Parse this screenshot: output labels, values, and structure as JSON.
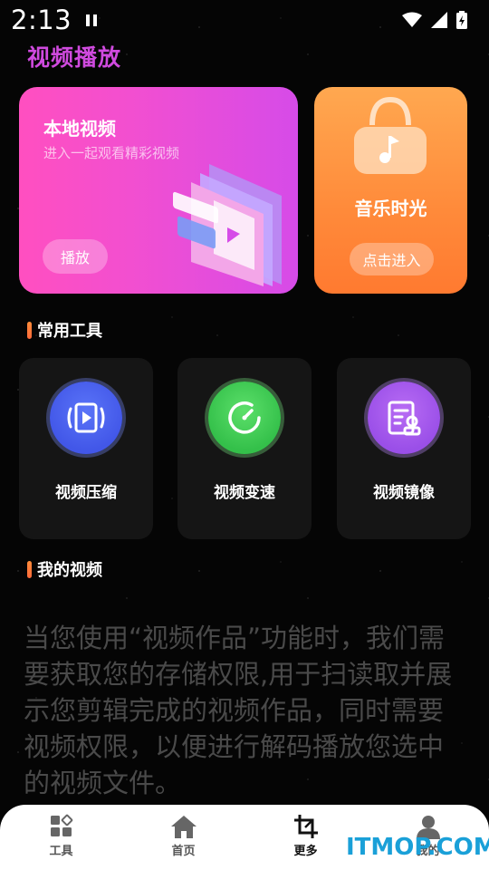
{
  "status_bar": {
    "time": "2:13"
  },
  "page_title": "视频播放",
  "local_video": {
    "title": "本地视频",
    "subtitle": "进入一起观看精彩视频",
    "button": "播放"
  },
  "music": {
    "title": "音乐时光",
    "button": "点击进入"
  },
  "tools_section": {
    "title": "常用工具",
    "items": [
      {
        "label": "视频压缩",
        "icon": "video-compress-icon",
        "color": "#4a5ef0"
      },
      {
        "label": "视频变速",
        "icon": "speedometer-icon",
        "color": "#3ccc50"
      },
      {
        "label": "视频镜像",
        "icon": "mirror-document-icon",
        "color": "#a45af0"
      }
    ]
  },
  "my_video_section": {
    "title": "我的视频"
  },
  "permission_text": "当您使用“视频作品”功能时，我们需要获取您的存储权限,用于扫读取并展示您剪辑完成的视频作品，同时需要视频权限，以便进行解码播放您选中的视频文件。",
  "bottom_nav": {
    "items": [
      {
        "label": "工具",
        "icon": "tools-grid-icon"
      },
      {
        "label": "首页",
        "icon": "home-icon"
      },
      {
        "label": "更多",
        "icon": "crop-icon",
        "active": true
      },
      {
        "label": "我的",
        "icon": "user-icon"
      }
    ]
  },
  "watermark": "ITMOP.COM",
  "colors": {
    "title_purple": "#d04adf",
    "local_card": "#f24fd0",
    "music_card": "#ff8a3a",
    "section_bar": "#ff7a3a"
  }
}
